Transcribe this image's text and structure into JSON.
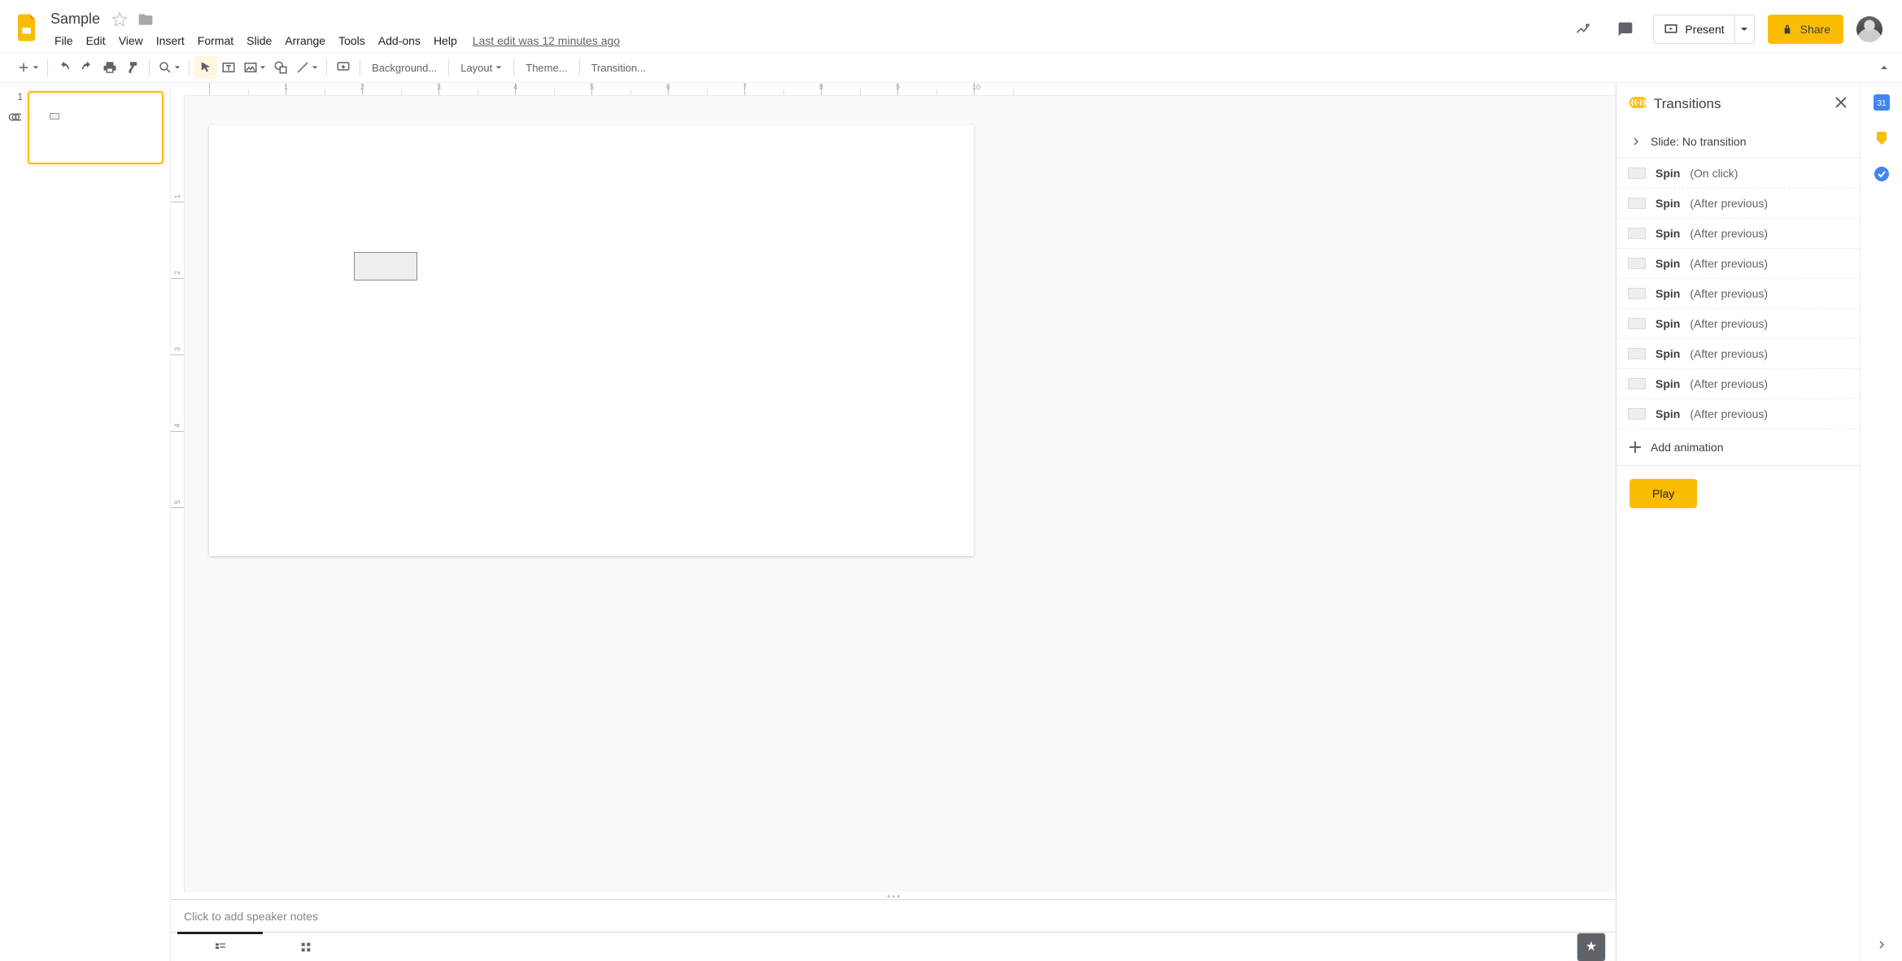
{
  "doc": {
    "title": "Sample",
    "last_edit": "Last edit was 12 minutes ago"
  },
  "menus": [
    "File",
    "Edit",
    "View",
    "Insert",
    "Format",
    "Slide",
    "Arrange",
    "Tools",
    "Add-ons",
    "Help"
  ],
  "header_buttons": {
    "present": "Present",
    "share": "Share"
  },
  "toolbar": {
    "background": "Background...",
    "layout": "Layout",
    "theme": "Theme...",
    "transition": "Transition..."
  },
  "thumb": {
    "number": "1"
  },
  "ruler": {
    "h": [
      " ",
      "1",
      "2",
      "3",
      "4",
      "5",
      "6",
      "7",
      "8",
      "9",
      "10"
    ],
    "v": [
      "1",
      "2",
      "3",
      "4",
      "5"
    ]
  },
  "speaker_notes_placeholder": "Click to add speaker notes",
  "sidebar": {
    "title": "Transitions",
    "slide_row": "Slide: No transition",
    "animations": [
      {
        "name": "Spin",
        "trigger": "(On click)"
      },
      {
        "name": "Spin",
        "trigger": "(After previous)"
      },
      {
        "name": "Spin",
        "trigger": "(After previous)"
      },
      {
        "name": "Spin",
        "trigger": "(After previous)"
      },
      {
        "name": "Spin",
        "trigger": "(After previous)"
      },
      {
        "name": "Spin",
        "trigger": "(After previous)"
      },
      {
        "name": "Spin",
        "trigger": "(After previous)"
      },
      {
        "name": "Spin",
        "trigger": "(After previous)"
      },
      {
        "name": "Spin",
        "trigger": "(After previous)"
      }
    ],
    "add_animation": "Add animation",
    "play": "Play"
  }
}
